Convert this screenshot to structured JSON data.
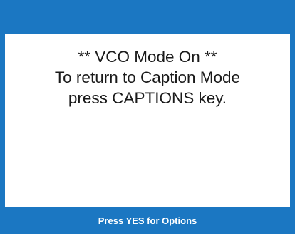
{
  "message": {
    "line1": "** VCO Mode On **",
    "line2": "To return to Caption Mode",
    "line3": "press CAPTIONS key."
  },
  "footer": {
    "hint": "Press YES for Options"
  },
  "colors": {
    "frame": "#1b77c2",
    "panel": "#ffffff",
    "text": "#1a1a1a",
    "footer_text": "#ffffff"
  }
}
